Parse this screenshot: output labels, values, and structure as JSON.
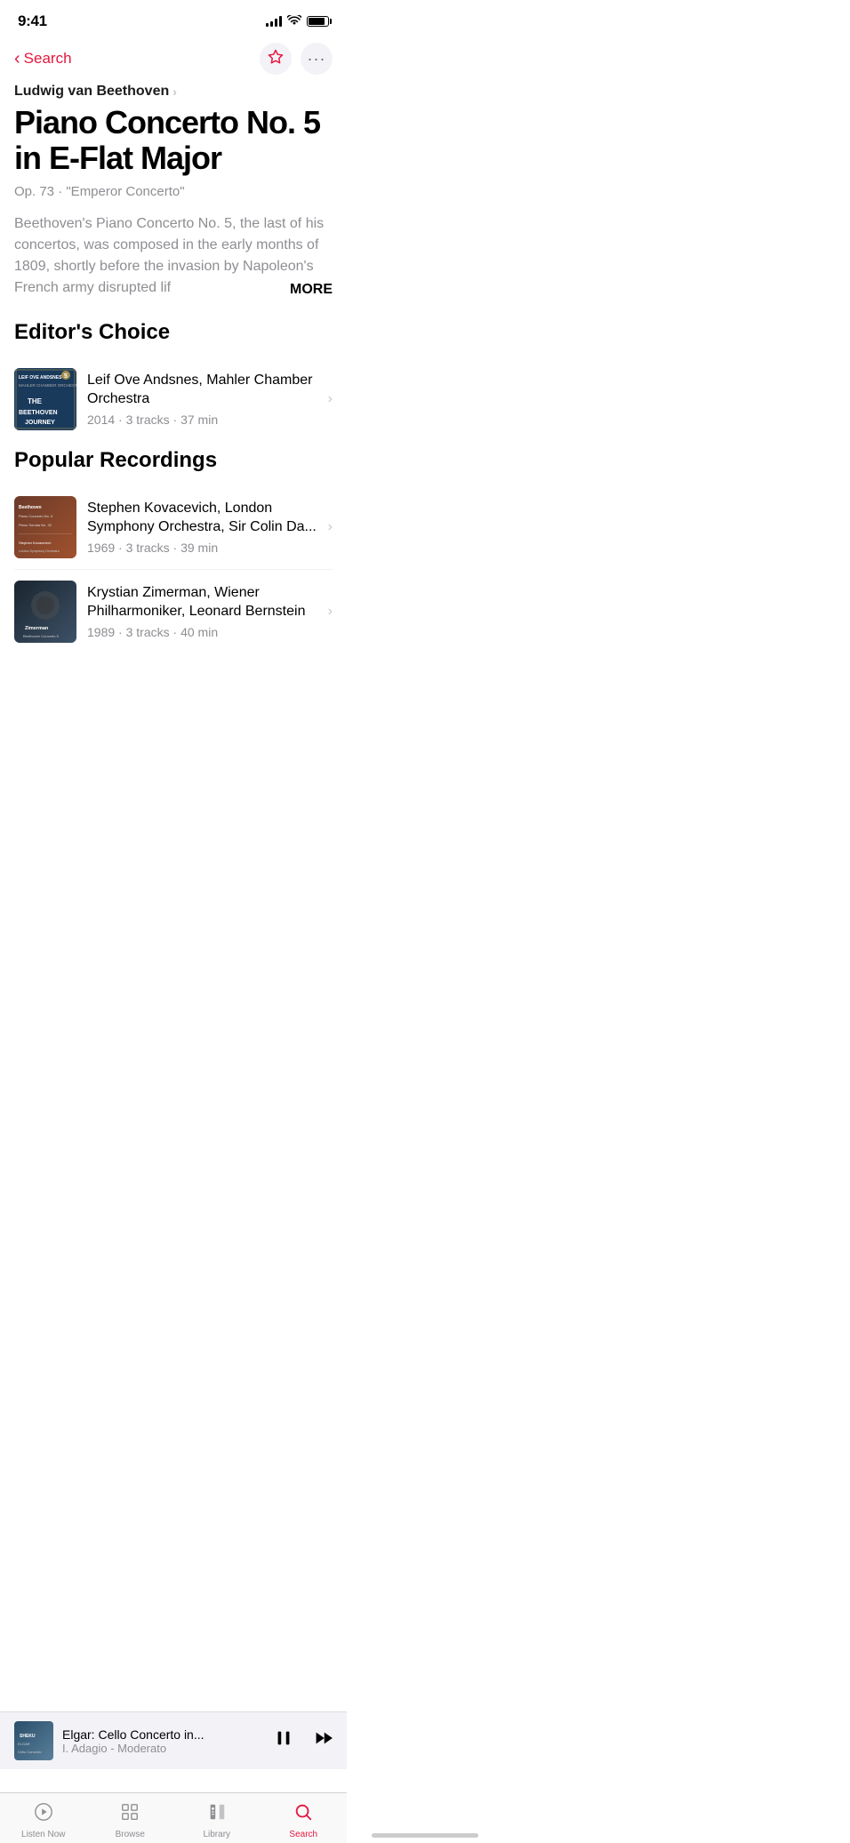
{
  "status": {
    "time": "9:41",
    "signal": 4,
    "wifi": true,
    "battery": 85
  },
  "nav": {
    "back_label": "Search",
    "favorite_tooltip": "Add to favorites",
    "more_tooltip": "More options"
  },
  "composer": {
    "name": "Ludwig van Beethoven",
    "link_label": "Ludwig van Beethoven"
  },
  "work": {
    "title": "Piano Concerto No. 5 in E-Flat Major",
    "subtitle": "Op. 73 · \"Emperor Concerto\"",
    "description": "Beethoven's Piano Concerto No. 5, the last of his concertos, was composed in the early months of 1809, shortly before the invasion by Napoleon's French army disrupted lif",
    "more_label": "MORE"
  },
  "editors_choice": {
    "section_title": "Editor's Choice",
    "item": {
      "artist": "Leif Ove Andsnes, Mahler Chamber Orchestra",
      "year": "2014",
      "tracks": "3 tracks",
      "duration": "37 min"
    }
  },
  "popular_recordings": {
    "section_title": "Popular Recordings",
    "items": [
      {
        "artist": "Stephen Kovacevich, London Symphony Orchestra, Sir Colin Da...",
        "year": "1969",
        "tracks": "3 tracks",
        "duration": "39 min"
      },
      {
        "artist": "Krystian Zimerman, Wiener Philharmoniker, Leonard Bernstein",
        "year": "1989",
        "tracks": "3 tracks",
        "duration": "40 min"
      }
    ]
  },
  "mini_player": {
    "title": "Elgar: Cello Concerto in...",
    "subtitle": "I. Adagio - Moderato"
  },
  "tab_bar": {
    "items": [
      {
        "label": "Listen Now",
        "icon": "▶",
        "active": false
      },
      {
        "label": "Browse",
        "icon": "⊞",
        "active": false
      },
      {
        "label": "Library",
        "icon": "♩",
        "active": false
      },
      {
        "label": "Search",
        "icon": "⌕",
        "active": true
      }
    ]
  }
}
